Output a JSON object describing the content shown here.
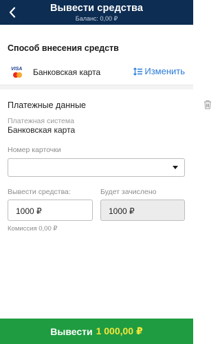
{
  "header": {
    "title": "Вывести средства",
    "balance_label": "Баланс:",
    "balance_value": "0,00 ₽"
  },
  "method": {
    "section_title": "Способ внесения средств",
    "selected_label": "Банковская карта",
    "change_label": "Изменить",
    "logo_text": "VISA"
  },
  "payment": {
    "title": "Платежные данные",
    "system_label": "Платежная система",
    "system_value": "Банковская карта",
    "card_label": "Номер карточки",
    "card_value": ""
  },
  "amounts": {
    "withdraw_label": "Вывести средства:",
    "withdraw_value": "1000 ₽",
    "credited_label": "Будет зачислено",
    "credited_value": "1000 ₽",
    "fee": "Комиссия 0,00 ₽"
  },
  "submit": {
    "label": "Вывести",
    "amount": "1 000,00 ₽"
  },
  "colors": {
    "header_bg": "#0d2d52",
    "accent": "#2a7bd8",
    "submit_bg": "#1f9c41",
    "submit_amount": "#f5e63b"
  }
}
